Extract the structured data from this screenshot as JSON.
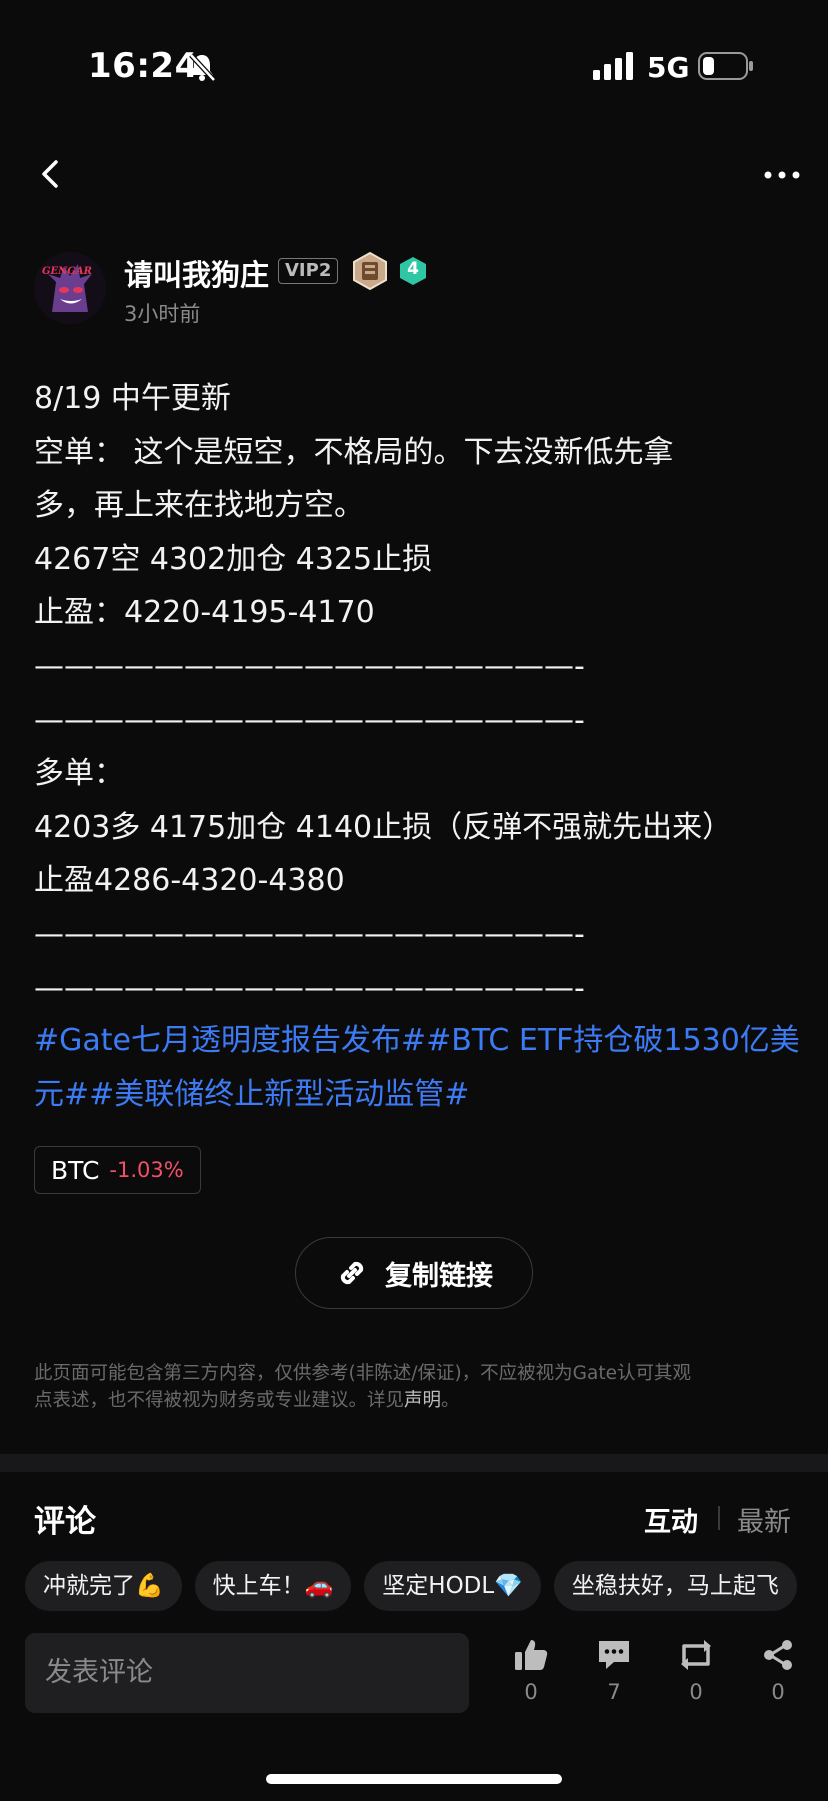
{
  "status_bar": {
    "time": "16:24",
    "network": "5G"
  },
  "post": {
    "author": {
      "name": "请叫我狗庄",
      "vip": "VIP2",
      "level": "4",
      "avatar_text": "GENGAR"
    },
    "time_ago": "3小时前",
    "lines": [
      "8/19 中午更新",
      "空单： 这个是短空，不格局的。下去没新低先拿",
      "多，再上来在找地方空。",
      "4267空 4302加仓 4325止损",
      "止盈：4220-4195-4170",
      "——————————————————-",
      "——————————————————-",
      "多单：",
      "4203多 4175加仓 4140止损（反弹不强就先出来）",
      "止盈4286-4320-4380",
      "——————————————————-",
      "——————————————————-"
    ],
    "tags": [
      "#Gate七月透明度报告发布#",
      "#BTC ETF持仓破1530亿美元#",
      "#美联储终止新型活动监管#"
    ],
    "ticker": {
      "symbol": "BTC",
      "change": "-1.03%"
    },
    "copy_link_label": "复制链接",
    "disclaimer": {
      "text_line1": "此页面可能包含第三方内容，仅供参考(非陈述/保证)，不应被视为Gate认可其观",
      "text_line2": "点表述，也不得被视为财务或专业建议。详见",
      "link": "声明",
      "end": "。"
    }
  },
  "comments": {
    "title": "评论",
    "sort_hot": "互动",
    "sort_new": "最新",
    "quick_replies": [
      "冲就完了💪",
      "快上车！🚗",
      "坚定HODL💎",
      "坐稳扶好，马上起飞"
    ],
    "input_placeholder": "发表评论"
  },
  "actions": {
    "like_count": "0",
    "comment_count": "7",
    "repost_count": "0",
    "share_count": "0"
  },
  "colors": {
    "background": "#0b0b0c",
    "tag_blue": "#3d7bf5",
    "negative_red": "#f0516a",
    "level_badge": "#2fc7a3"
  }
}
